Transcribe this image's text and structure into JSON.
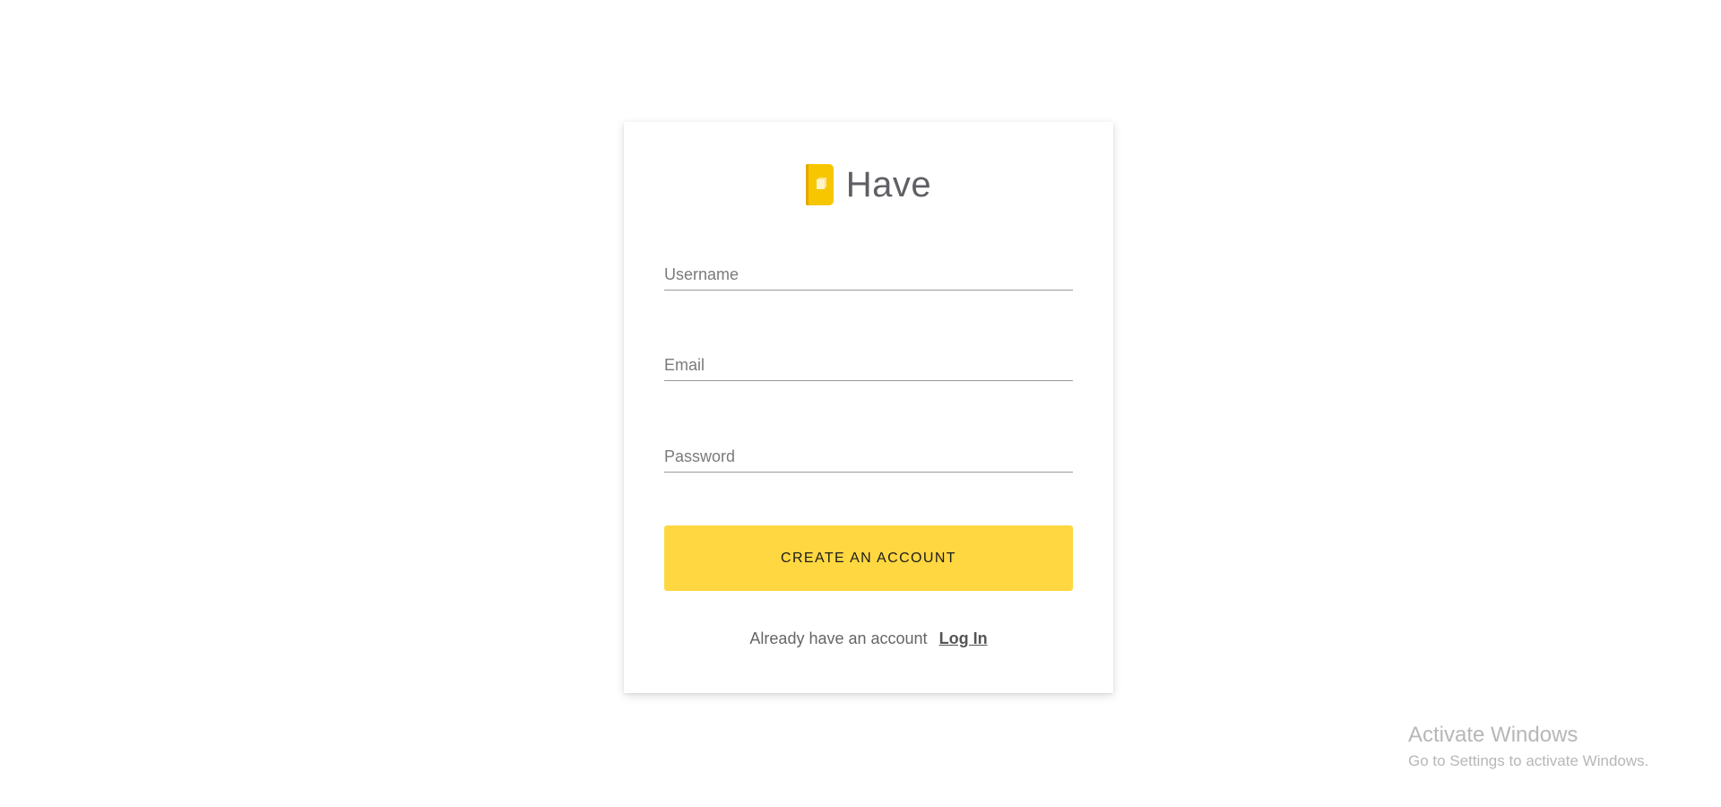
{
  "brand": {
    "name": "Have",
    "logo_icon": "book-icon",
    "logo_color": "#f7c600"
  },
  "form": {
    "username": {
      "placeholder": "Username",
      "value": ""
    },
    "email": {
      "placeholder": "Email",
      "value": ""
    },
    "password": {
      "placeholder": "Password",
      "value": ""
    },
    "submit_label": "CREATE AN ACCOUNT",
    "submit_color": "#ffd740"
  },
  "footer": {
    "prompt": "Already have an account",
    "login_link": "Log In"
  },
  "watermark": {
    "title": "Activate Windows",
    "subtitle": "Go to Settings to activate Windows."
  }
}
